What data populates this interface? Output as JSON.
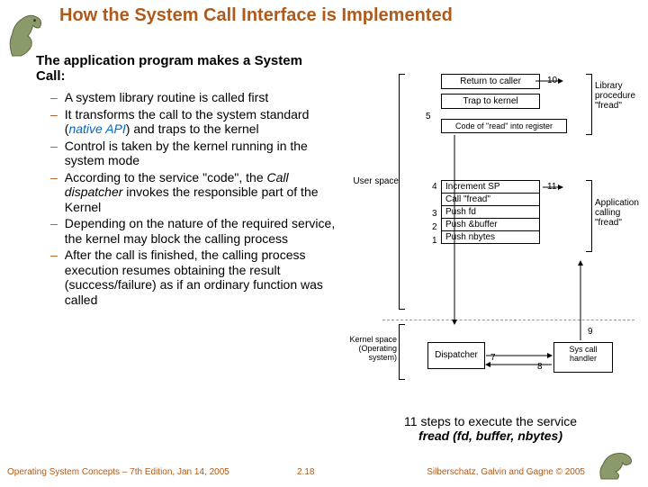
{
  "title": "How the System Call Interface is Implemented",
  "lead": "The application program makes a System Call:",
  "bullets": [
    "A system library routine is called first",
    "It transforms the call to the system standard (|native API|) and traps to the kernel",
    "Control is taken by the kernel running in the system mode",
    "According to the service \"code\", the |Call dispatcher| invokes the responsible part of the Kernel",
    "Depending on the nature of the required service, the kernel may block the calling process",
    "After the call is finished, the calling process execution resumes obtaining the result (success/failure) as if an ordinary function was called"
  ],
  "caption_line1": "11 steps to execute the service",
  "caption_code": "fread (fd, buffer, nbytes)",
  "footer": {
    "left": "Operating System Concepts – 7th Edition, Jan 14, 2005",
    "mid": "2.18",
    "right": "Silberschatz, Galvin and Gagne © 2005"
  },
  "diagram": {
    "top_boxes": [
      "Return to caller",
      "Trap to kernel",
      "Code of \"read\" into register"
    ],
    "stack": [
      "Increment SP",
      "Call \"fread\"",
      "Push fd",
      "Push &buffer",
      "Push nbytes"
    ],
    "stack_nums": [
      "4",
      "3",
      "2",
      "1"
    ],
    "kernel_boxes": [
      "Dispatcher",
      "Sys call handler"
    ],
    "nums": {
      "n5": "5",
      "n7": "7",
      "n8": "8",
      "n9": "9",
      "n10": "10",
      "n11": "11"
    },
    "labels": {
      "user_space": "User space",
      "kernel_space": "Kernel space (Operating system)",
      "lib_proc": "Library procedure \"fread\"",
      "app_call": "Application calling \"fread\""
    }
  }
}
